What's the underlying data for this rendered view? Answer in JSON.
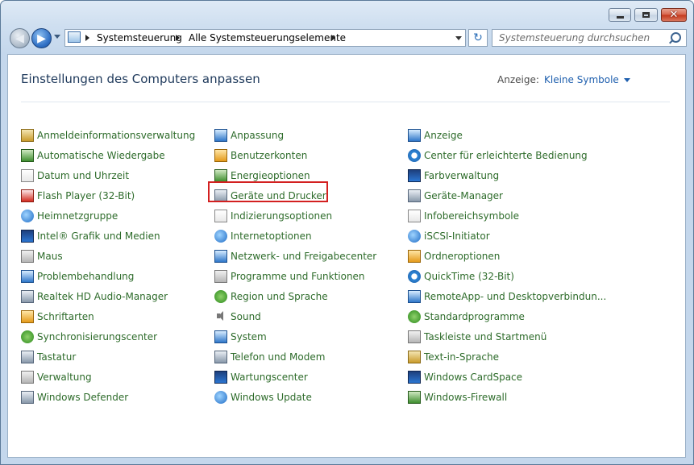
{
  "breadcrumb": [
    "Systemsteuerung",
    "Alle Systemsteuerungselemente"
  ],
  "search": {
    "placeholder": "Systemsteuerung durchsuchen"
  },
  "main": {
    "heading": "Einstellungen des Computers anpassen",
    "view_label": "Anzeige:",
    "view_value": "Kleine Symbole"
  },
  "columns": [
    [
      {
        "label": "Anmeldeinformationsverwaltung",
        "icon": "credential-vault-icon"
      },
      {
        "label": "Automatische Wiedergabe",
        "icon": "autoplay-icon"
      },
      {
        "label": "Datum und Uhrzeit",
        "icon": "clock-icon"
      },
      {
        "label": "Flash Player (32-Bit)",
        "icon": "flash-icon"
      },
      {
        "label": "Heimnetzgruppe",
        "icon": "homegroup-icon"
      },
      {
        "label": "Intel® Grafik und Medien",
        "icon": "intel-icon"
      },
      {
        "label": "Maus",
        "icon": "mouse-icon"
      },
      {
        "label": "Problembehandlung",
        "icon": "troubleshoot-icon"
      },
      {
        "label": "Realtek HD Audio-Manager",
        "icon": "audio-manager-icon"
      },
      {
        "label": "Schriftarten",
        "icon": "fonts-icon"
      },
      {
        "label": "Synchronisierungscenter",
        "icon": "sync-icon"
      },
      {
        "label": "Tastatur",
        "icon": "keyboard-icon"
      },
      {
        "label": "Verwaltung",
        "icon": "admin-tools-icon"
      },
      {
        "label": "Windows Defender",
        "icon": "defender-icon"
      }
    ],
    [
      {
        "label": "Anpassung",
        "icon": "personalization-icon"
      },
      {
        "label": "Benutzerkonten",
        "icon": "user-accounts-icon"
      },
      {
        "label": "Energieoptionen",
        "icon": "power-icon"
      },
      {
        "label": "Geräte und Drucker",
        "icon": "printer-icon"
      },
      {
        "label": "Indizierungsoptionen",
        "icon": "indexing-icon"
      },
      {
        "label": "Internetoptionen",
        "icon": "internet-icon"
      },
      {
        "label": "Netzwerk- und Freigabecenter",
        "icon": "network-icon"
      },
      {
        "label": "Programme und Funktionen",
        "icon": "programs-icon"
      },
      {
        "label": "Region und Sprache",
        "icon": "globe-icon"
      },
      {
        "label": "Sound",
        "icon": "speaker-icon"
      },
      {
        "label": "System",
        "icon": "system-icon"
      },
      {
        "label": "Telefon und Modem",
        "icon": "phone-icon"
      },
      {
        "label": "Wartungscenter",
        "icon": "flag-icon"
      },
      {
        "label": "Windows Update",
        "icon": "windows-update-icon"
      }
    ],
    [
      {
        "label": "Anzeige",
        "icon": "display-icon"
      },
      {
        "label": "Center für erleichterte Bedienung",
        "icon": "accessibility-icon"
      },
      {
        "label": "Farbverwaltung",
        "icon": "color-management-icon"
      },
      {
        "label": "Geräte-Manager",
        "icon": "device-manager-icon"
      },
      {
        "label": "Infobereichsymbole",
        "icon": "tray-icon"
      },
      {
        "label": "iSCSI-Initiator",
        "icon": "iscsi-icon"
      },
      {
        "label": "Ordneroptionen",
        "icon": "folder-icon"
      },
      {
        "label": "QuickTime (32-Bit)",
        "icon": "quicktime-icon"
      },
      {
        "label": "RemoteApp- und Desktopverbindun...",
        "icon": "remoteapp-icon"
      },
      {
        "label": "Standardprogramme",
        "icon": "default-programs-icon"
      },
      {
        "label": "Taskleiste und Startmenü",
        "icon": "taskbar-icon"
      },
      {
        "label": "Text-in-Sprache",
        "icon": "speech-icon"
      },
      {
        "label": "Windows CardSpace",
        "icon": "cardspace-icon"
      },
      {
        "label": "Windows-Firewall",
        "icon": "firewall-icon"
      }
    ]
  ]
}
